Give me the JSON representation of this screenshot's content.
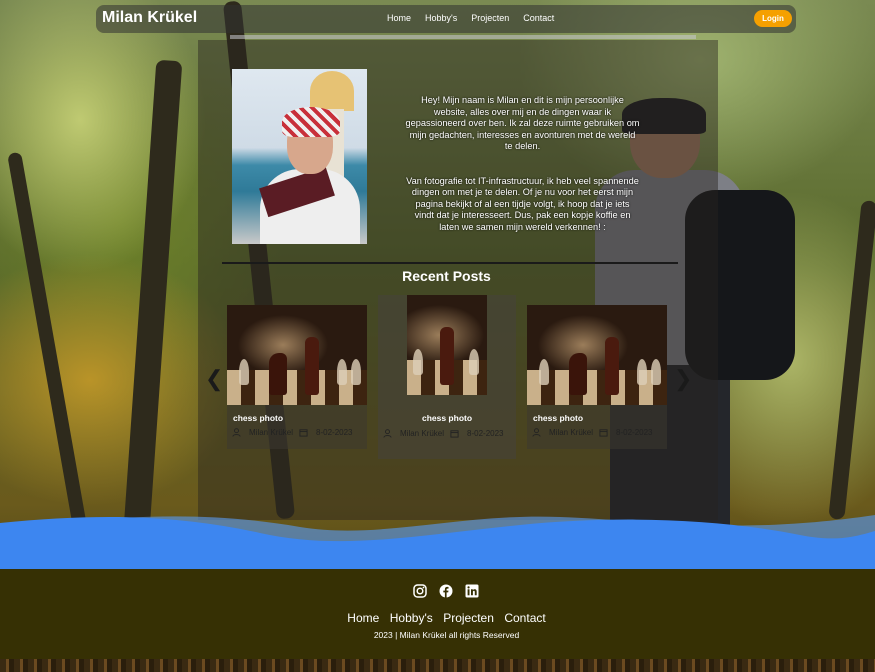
{
  "header": {
    "brand": "Milan Krükel",
    "nav": [
      "Home",
      "Hobby's",
      "Projecten",
      "Contact"
    ],
    "login_label": "Login"
  },
  "about": {
    "paragraph_1": "Hey! Mijn naam is Milan en dit is mijn persoonlijke website, alles over mij en de dingen waar ik gepassioneerd over ben. Ik zal deze ruimte gebruiken om mijn gedachten, interesses en avonturen met de wereld te delen.",
    "paragraph_2": "Van fotografie tot IT-infrastructuur, ik heb veel spannende dingen om met je te delen. Of je nu voor het eerst mijn pagina bekijkt of al een tijdje volgt, ik hoop dat je iets vindt dat je interesseert. Dus, pak een kopje koffie en laten we samen mijn wereld verkennen! :"
  },
  "recent_posts": {
    "title": "Recent Posts",
    "prev_icon": "chevron-left-icon",
    "next_icon": "chevron-right-icon",
    "posts": [
      {
        "title": "chess photo",
        "author": "Milan Krükel",
        "date": "8-02-2023"
      },
      {
        "title": "chess photo",
        "author": "Milan Krükel",
        "date": "8-02-2023"
      },
      {
        "title": "chess photo",
        "author": "Milan Krükel",
        "date": "8-02-2023"
      }
    ]
  },
  "footer": {
    "social_icons": [
      "instagram-icon",
      "facebook-icon",
      "linkedin-icon"
    ],
    "links": [
      "Home",
      "Hobby's",
      "Projecten",
      "Contact"
    ],
    "copyright": "2023 | Milan Krükel all rights Reserved"
  },
  "colors": {
    "login_button": "#f5a000",
    "wave": "#3d86f0",
    "footer_bg": "#363004"
  }
}
